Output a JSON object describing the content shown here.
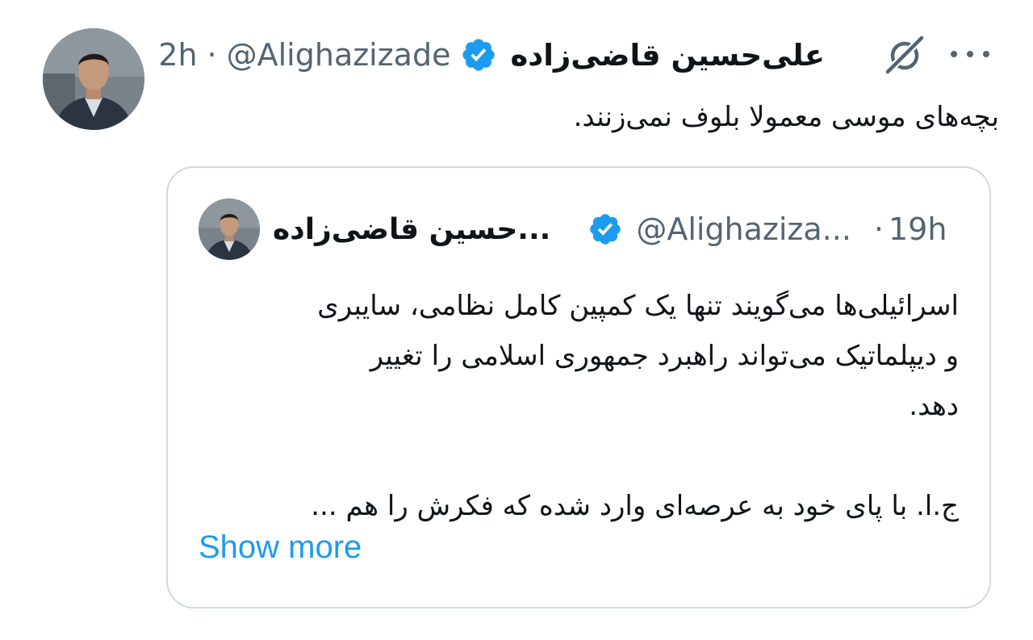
{
  "tweet": {
    "author_name": "علی‌حسین قاضی‌زاده",
    "handle": "@Alighazizade",
    "separator": "·",
    "time": "2h",
    "text": "بچه‌های موسی معمولا بلوف نمی‌زنند.",
    "icons": {
      "avatar": "profile-photo",
      "verified": "verified-badge-icon",
      "grok": "grok-icon",
      "more": "more-options-icon"
    },
    "accent_color": "#1d9bf0"
  },
  "quote": {
    "author_name": "...حسین قاضی‌زاده",
    "handle": "@Alighaziza...",
    "separator": "·",
    "time": "19h",
    "text_line_1": "اسرائیلی‌ها می‌گویند تنها یک کمپین کامل نظامی، سایبری",
    "text_line_2": "و دیپلماتیک می‌تواند راهبرد جمهوری اسلامی را تغییر",
    "text_line_3": "دهد.",
    "text_line_4": "ج.ا. با پای خود به عرصه‌ای وارد شده که فکرش را هم ...",
    "show_more": "Show more"
  }
}
